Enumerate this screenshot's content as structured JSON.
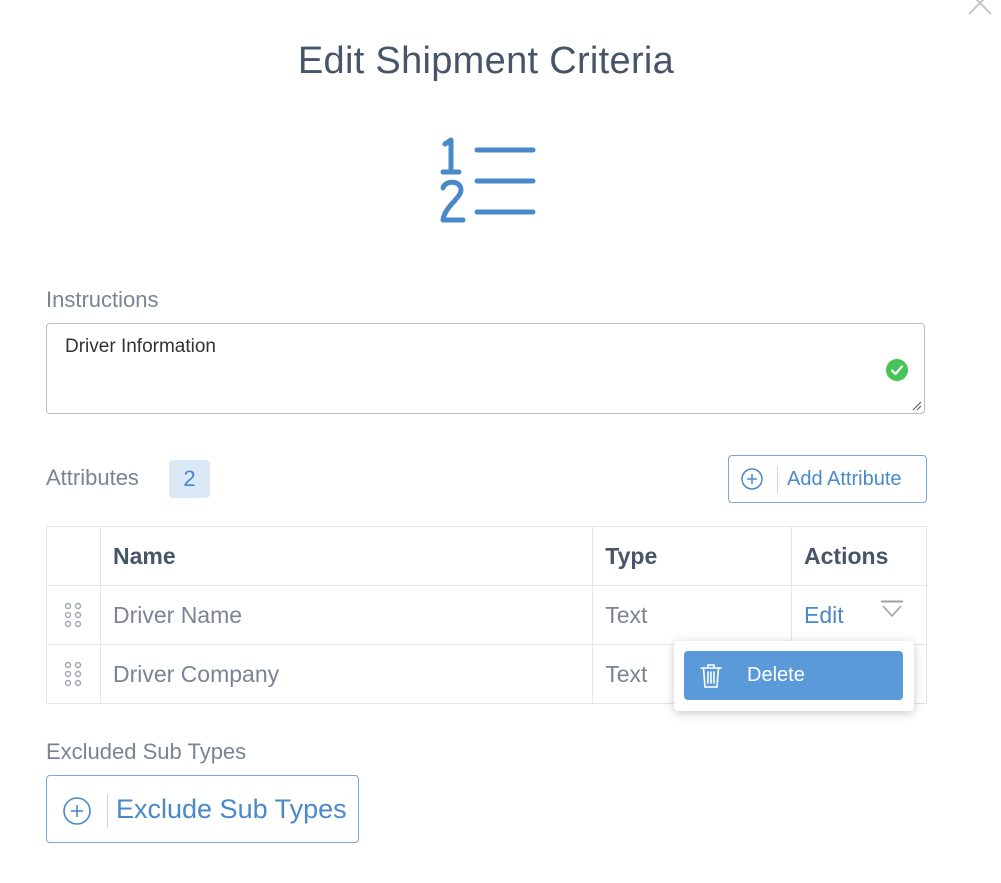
{
  "modal": {
    "title": "Edit Shipment Criteria"
  },
  "instructions": {
    "label": "Instructions",
    "value": "Driver Information"
  },
  "attributes": {
    "label": "Attributes",
    "count": "2",
    "add_button": "Add Attribute",
    "columns": {
      "name": "Name",
      "type": "Type",
      "actions": "Actions"
    },
    "rows": [
      {
        "name": "Driver Name",
        "type": "Text",
        "action": "Edit"
      },
      {
        "name": "Driver Company",
        "type": "Text"
      }
    ],
    "menu": {
      "delete_label": "Delete"
    }
  },
  "excluded_sub_types": {
    "label": "Excluded Sub Types",
    "button": "Exclude Sub Types"
  },
  "colors": {
    "accent": "#4a89c9",
    "menu_item_bg": "#5b9ad9",
    "valid_green": "#47c45a",
    "badge_bg": "#dbe8f6"
  },
  "icons": [
    "close-icon",
    "numbered-list-icon",
    "check-circle-icon",
    "plus-circle-icon",
    "drag-handle-icon",
    "chevron-down-icon",
    "trash-icon"
  ]
}
